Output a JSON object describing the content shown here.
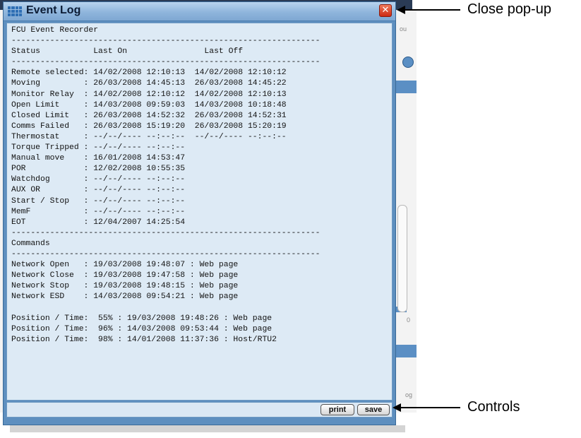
{
  "window": {
    "title": "Event Log",
    "close_glyph": "✕"
  },
  "log_lines": [
    "FCU Event Recorder",
    "----------------------------------------------------------------",
    "Status           Last On                Last Off",
    "----------------------------------------------------------------",
    "Remote selected: 14/02/2008 12:10:13  14/02/2008 12:10:12",
    "Moving         : 26/03/2008 14:45:13  26/03/2008 14:45:22",
    "Monitor Relay  : 14/02/2008 12:10:12  14/02/2008 12:10:13",
    "Open Limit     : 14/03/2008 09:59:03  14/03/2008 10:18:48",
    "Closed Limit   : 26/03/2008 14:52:32  26/03/2008 14:52:31",
    "Comms Failed   : 26/03/2008 15:19:20  26/03/2008 15:20:19",
    "Thermostat     : --/--/---- --:--:--  --/--/---- --:--:--",
    "Torque Tripped : --/--/---- --:--:--",
    "Manual move    : 16/01/2008 14:53:47",
    "POR            : 12/02/2008 10:55:35",
    "Watchdog       : --/--/---- --:--:--",
    "AUX OR         : --/--/---- --:--:--",
    "Start / Stop   : --/--/---- --:--:--",
    "MemF           : --/--/---- --:--:--",
    "EOT            : 12/04/2007 14:25:54",
    "----------------------------------------------------------------",
    "Commands",
    "----------------------------------------------------------------",
    "Network Open   : 19/03/2008 19:48:07 : Web page",
    "Network Close  : 19/03/2008 19:47:58 : Web page",
    "Network Stop   : 19/03/2008 19:48:15 : Web page",
    "Network ESD    : 14/03/2008 09:54:21 : Web page",
    "",
    "Position / Time:  55% : 19/03/2008 19:48:26 : Web page",
    "Position / Time:  96% : 14/03/2008 09:53:44 : Web page",
    "Position / Time:  98% : 14/01/2008 11:37:36 : Host/RTU2"
  ],
  "controls": {
    "print_label": "print",
    "save_label": "save"
  },
  "annotations": {
    "close_popup": "Close pop-up",
    "controls": "Controls"
  },
  "background": {
    "frag_top": "ou",
    "frag_bottom": "og",
    "frag_side": "0"
  }
}
